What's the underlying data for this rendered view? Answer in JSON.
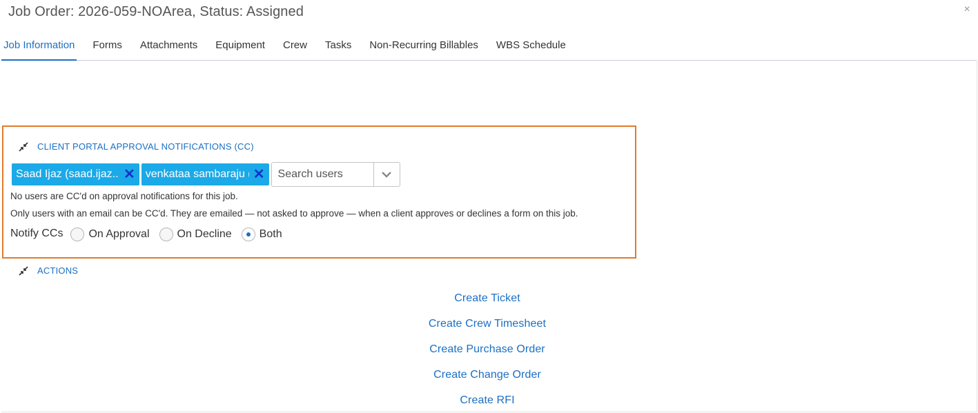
{
  "window": {
    "title": "Job Order: 2026-059-NOArea, Status: Assigned",
    "close_glyph": "×"
  },
  "tabs": [
    {
      "label": "Job Information",
      "active": true
    },
    {
      "label": "Forms",
      "active": false
    },
    {
      "label": "Attachments",
      "active": false
    },
    {
      "label": "Equipment",
      "active": false
    },
    {
      "label": "Crew",
      "active": false
    },
    {
      "label": "Tasks",
      "active": false
    },
    {
      "label": "Non-Recurring Billables",
      "active": false
    },
    {
      "label": "WBS Schedule",
      "active": false
    }
  ],
  "cc_section": {
    "title": "CLIENT PORTAL APPROVAL NOTIFICATIONS (CC)",
    "chips": [
      {
        "label": "Saad Ijaz (saad.ijaz...",
        "remove": "✕"
      },
      {
        "label": "venkataa sambaraju (...",
        "remove": "✕"
      }
    ],
    "search": {
      "placeholder": "Search users",
      "value": ""
    },
    "info_no_users": "No users are CC'd on approval notifications for this job.",
    "info_rules": "Only users with an email can be CC'd. They are emailed — not asked to approve — when a client approves or declines a form on this job.",
    "notify": {
      "label": "Notify CCs",
      "options": [
        {
          "label": "On Approval",
          "checked": false
        },
        {
          "label": "On Decline",
          "checked": false
        },
        {
          "label": "Both",
          "checked": true
        }
      ]
    }
  },
  "actions_section": {
    "title": "ACTIONS",
    "links": [
      "Create Ticket",
      "Create Crew Timesheet",
      "Create Purchase Order",
      "Create Change Order",
      "Create RFI"
    ]
  },
  "colors": {
    "accent": "#1a6fc4",
    "chip_bg": "#1ba9e8",
    "chip_remove": "#1233c9",
    "highlight_border": "#e07b2c"
  },
  "icons": {
    "collapse": "collapse-arrows-icon",
    "dropdown": "chevron-down-icon",
    "close": "close-icon",
    "remove": "remove-icon"
  }
}
